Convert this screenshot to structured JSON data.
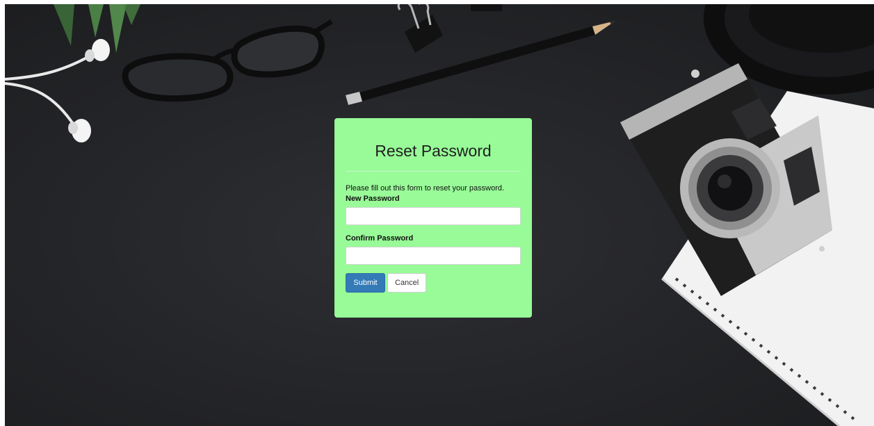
{
  "form": {
    "title": "Reset Password",
    "instructions": "Please fill out this form to reset your password.",
    "new_password": {
      "label": "New Password",
      "value": "",
      "placeholder": ""
    },
    "confirm_password": {
      "label": "Confirm Password",
      "value": "",
      "placeholder": ""
    },
    "submit_label": "Submit",
    "cancel_label": "Cancel"
  },
  "colors": {
    "card_background": "#98fb98",
    "primary_button": "#337ab7",
    "desk_background": "#232427"
  },
  "icons": {
    "background_objects": [
      "earphones",
      "potted-plant",
      "eyeglasses",
      "binder-clip",
      "pencil",
      "camera",
      "spiral-notebook",
      "round-dish"
    ]
  }
}
